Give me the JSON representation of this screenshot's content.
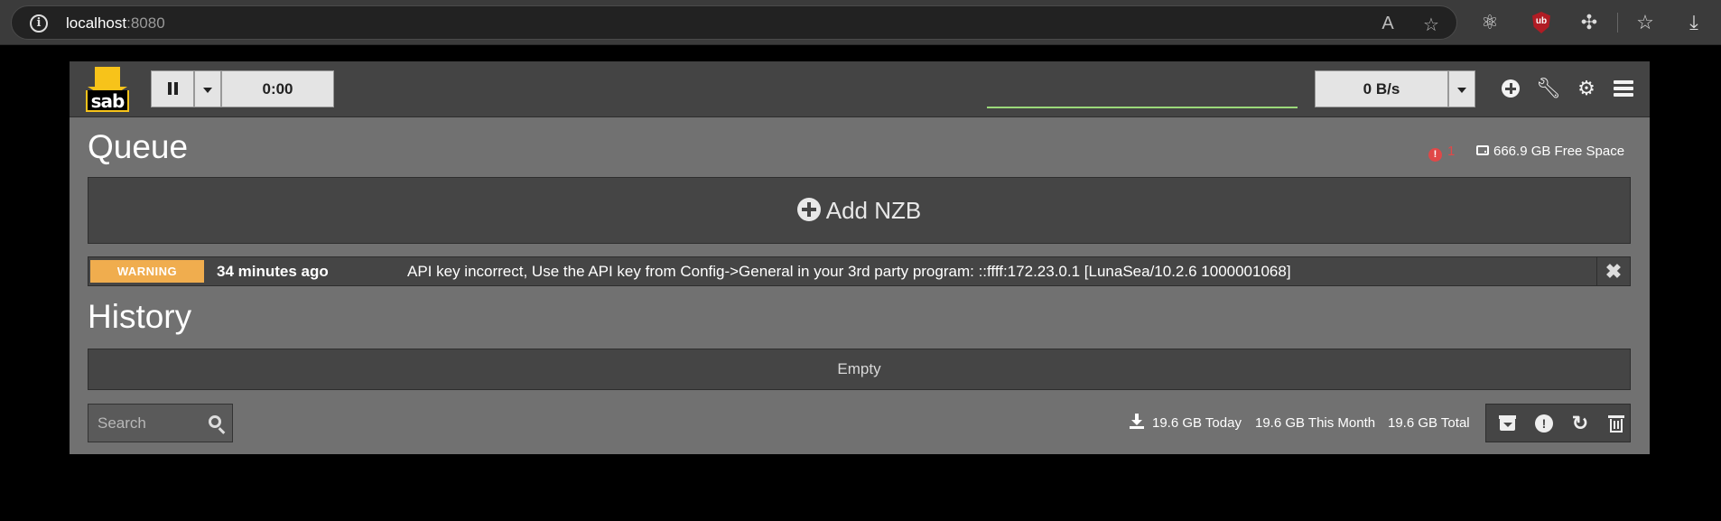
{
  "browser": {
    "url_host": "localhost",
    "url_port": ":8080"
  },
  "header": {
    "logo_text": "sab",
    "timer": "0:00",
    "speed": "0 B/s"
  },
  "queue": {
    "title": "Queue",
    "warning_count": "1",
    "free_space": "666.9 GB Free Space",
    "add_nzb_label": "Add NZB"
  },
  "warning": {
    "label": "WARNING",
    "time": "34 minutes ago",
    "message": "API key incorrect, Use the API key from Config->General in your 3rd party program: ::ffff:172.23.0.1 [LunaSea/10.2.6 1000001068]"
  },
  "history": {
    "title": "History",
    "empty_label": "Empty",
    "search_placeholder": "Search",
    "today": "19.6 GB Today",
    "month": "19.6 GB This Month",
    "total": "19.6 GB Total"
  },
  "colors": {
    "warning_badge": "#f0ad4e",
    "logo_yellow": "#f7c31a",
    "alert_red": "#e04848",
    "speed_line": "#9bd97a"
  },
  "icons": [
    "info-icon",
    "read-aloud-icon",
    "favorite-star-icon",
    "react-devtools-icon",
    "ublock-icon",
    "extensions-icon",
    "favorites-icon",
    "downloads-icon",
    "pause-icon",
    "add-icon",
    "wrench-icon",
    "gear-icon",
    "menu-icon",
    "alert-icon",
    "drive-icon",
    "close-icon",
    "search-icon",
    "download-icon",
    "archive-icon",
    "refresh-icon",
    "trash-icon"
  ]
}
